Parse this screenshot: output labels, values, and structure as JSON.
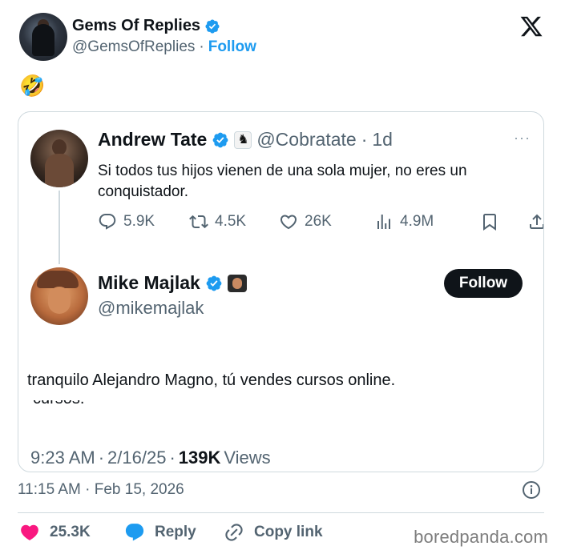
{
  "outer": {
    "name": "Gems Of Replies",
    "handle": "@GemsOfReplies",
    "separator": "·",
    "follow_label": "Follow",
    "emoji": "🤣"
  },
  "quoted_tweet": {
    "name": "Andrew Tate",
    "handle": "@Cobratate",
    "dot": "·",
    "age": "1d",
    "more": "···",
    "text": "Si todos tus hijos vienen de una sola mujer, no eres un conquistador.",
    "replies": "5.9K",
    "reposts": "4.5K",
    "likes": "26K",
    "views": "4.9M"
  },
  "reply": {
    "name": "Mike Majlak",
    "handle": "@mikemajlak",
    "follow_label": "Follow",
    "text": "tranquilo Alejandro Magno, tú vendes cursos online.",
    "cutoff_text": "cursos.",
    "time": "9:23 AM",
    "date": "2/16/25",
    "views_count": "139K",
    "views_label": "Views",
    "dot": "·"
  },
  "timestamp": "11:15 AM · Feb 15, 2026",
  "footer": {
    "likes": "25.3K",
    "reply_label": "Reply",
    "copy_link_label": "Copy link"
  },
  "watermark": "boredpanda.com",
  "colors": {
    "accent": "#1d9bf0",
    "text": "#0f1419",
    "muted": "#536471",
    "like": "#f91880",
    "border": "#cfd9de"
  }
}
